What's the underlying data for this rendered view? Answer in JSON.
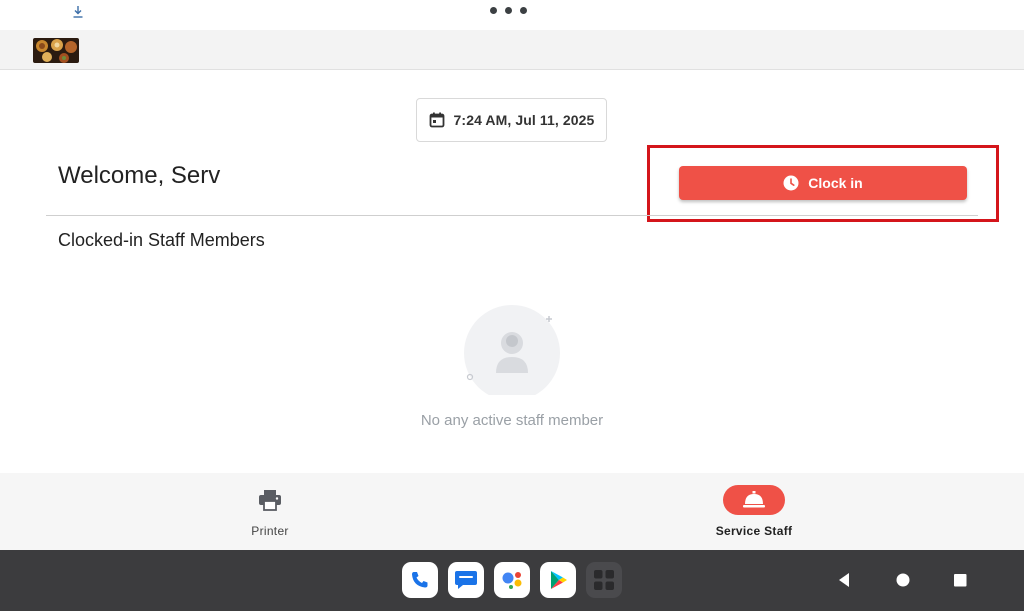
{
  "status_bar": {
    "download_icon": "download-icon",
    "more_icon": "three-dots-icon"
  },
  "app_bar": {
    "logo": "food-logo"
  },
  "datetime": {
    "icon": "calendar-icon",
    "text": "7:24 AM, Jul 11, 2025"
  },
  "welcome": {
    "text": "Welcome, Serv"
  },
  "clock_in": {
    "label": "Clock in",
    "icon": "clock-icon",
    "color": "#ef5147"
  },
  "highlight_color": "#d4151b",
  "staff_section": {
    "title": "Clocked-in Staff Members",
    "empty_text": "No any active staff member"
  },
  "bottom_nav": {
    "items": [
      {
        "label": "Printer",
        "icon": "printer-icon",
        "active": false
      },
      {
        "label": "Service Staff",
        "icon": "service-bell-icon",
        "active": true
      }
    ]
  },
  "system_bar": {
    "dock": [
      "phone-icon",
      "messages-icon",
      "assistant-icon",
      "play-store-icon",
      "app-grid-icon"
    ],
    "nav": [
      "back-icon",
      "home-icon",
      "recents-icon"
    ]
  }
}
